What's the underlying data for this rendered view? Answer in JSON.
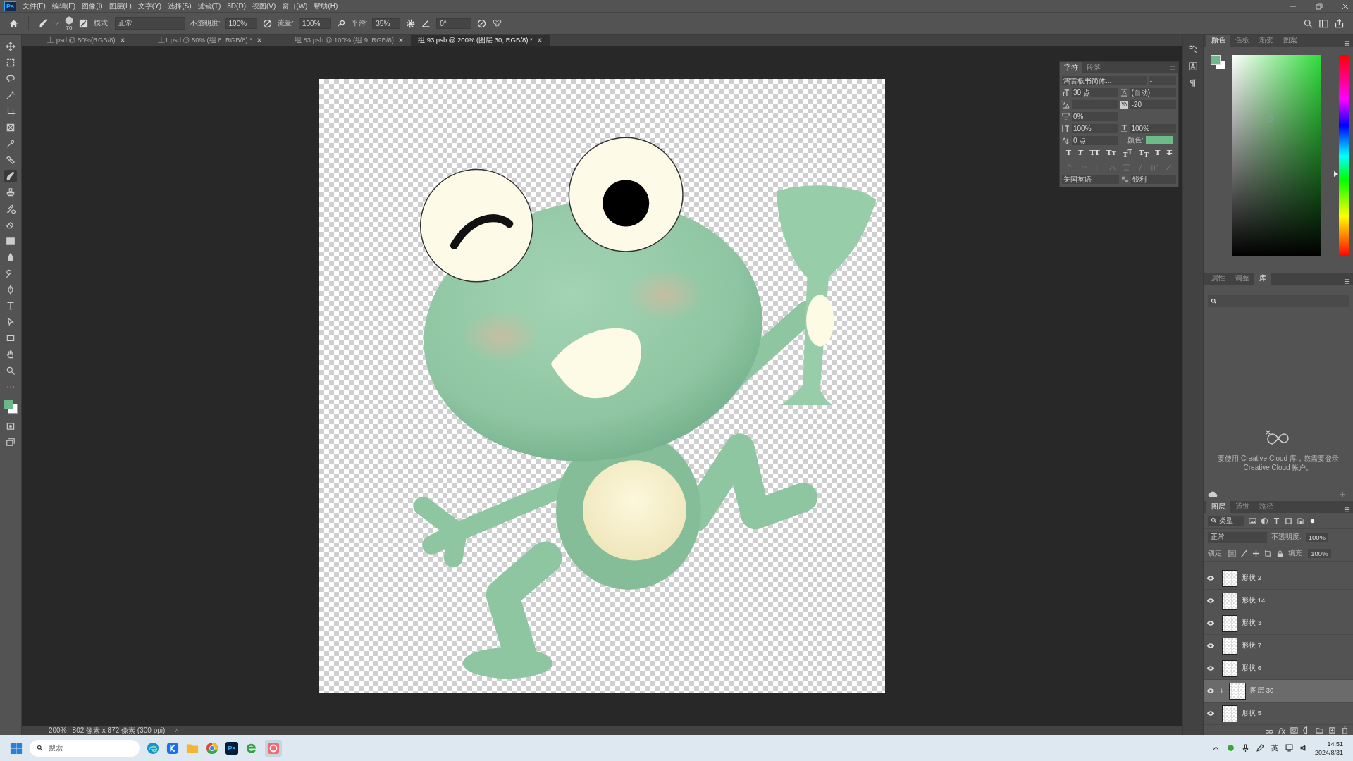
{
  "app_logo": "Ps",
  "menu": [
    "文件(F)",
    "编辑(E)",
    "图像(I)",
    "图层(L)",
    "文字(Y)",
    "选择(S)",
    "滤镜(T)",
    "3D(D)",
    "视图(V)",
    "窗口(W)",
    "帮助(H)"
  ],
  "options_bar": {
    "brush_size": "70",
    "mode_label": "模式:",
    "mode": "正常",
    "opacity_label": "不透明度:",
    "opacity": "100%",
    "flow_label": "流量:",
    "flow": "100%",
    "smoothing_label": "平滑:",
    "smoothing": "35%",
    "angle": "0°"
  },
  "hue_slider": {
    "level": 0.41
  },
  "tools": [
    {
      "kind": "move",
      "selected": false
    },
    {
      "kind": "marquee",
      "selected": false
    },
    {
      "kind": "lasso",
      "selected": false
    },
    {
      "kind": "wand",
      "selected": false
    },
    {
      "kind": "crop",
      "selected": false
    },
    {
      "kind": "frame",
      "selected": false
    },
    {
      "kind": "eyedropper",
      "selected": false
    },
    {
      "kind": "healing",
      "selected": false
    },
    {
      "kind": "brush",
      "selected": true
    },
    {
      "kind": "stamp",
      "selected": false
    },
    {
      "kind": "history",
      "selected": false
    },
    {
      "kind": "eraser",
      "selected": false
    },
    {
      "kind": "gradient",
      "selected": false
    },
    {
      "kind": "blur",
      "selected": false
    },
    {
      "kind": "dodge",
      "selected": false
    },
    {
      "kind": "pen",
      "selected": false
    },
    {
      "kind": "type",
      "selected": false
    },
    {
      "kind": "select",
      "selected": false
    },
    {
      "kind": "rectangle",
      "selected": false
    },
    {
      "kind": "hand",
      "selected": false
    },
    {
      "kind": "zoom",
      "selected": false
    },
    {
      "kind": "more",
      "selected": false
    }
  ],
  "document_tabs": [
    {
      "title": "土.psd @ 50%(RGB/8)",
      "selected": false
    },
    {
      "title": "土1.psd @ 50% (组 8, RGB/8) *",
      "selected": false
    },
    {
      "title": "组 83.psb @ 100% (组 9, RGB/8)",
      "selected": false
    },
    {
      "title": "组 93.psb @ 200% (图层 30, RGB/8) *",
      "selected": true
    }
  ],
  "character_panel": {
    "tabs": [
      {
        "label": "字符",
        "selected": true
      },
      {
        "label": "段落",
        "selected": false
      }
    ],
    "font_family": "鸿雷板书简体...",
    "font_style": "-",
    "font_size": "30 点",
    "leading": "(自动)",
    "tracking": "-20",
    "tsume": "0%",
    "vertical_scale": "100%",
    "horizontal_scale": "100%",
    "baseline_shift": "0 点",
    "color_label": "颜色:",
    "color": "#6dbb88",
    "style_buttons": [
      "T",
      "T",
      "TT",
      "Tᴛ",
      "T$^{T}$",
      "T$_{T}$",
      "T",
      "T"
    ],
    "language": "美国英语",
    "antialias": "锐利"
  },
  "color_panel": {
    "tabs": [
      {
        "label": "颜色",
        "selected": true
      },
      {
        "label": "色板",
        "selected": false
      },
      {
        "label": "渐变",
        "selected": false
      },
      {
        "label": "图案",
        "selected": false
      }
    ]
  },
  "library_panel": {
    "tabs": [
      {
        "label": "属性",
        "selected": false
      },
      {
        "label": "调整",
        "selected": false
      },
      {
        "label": "库",
        "selected": true
      }
    ],
    "message": "要使用 Creative Cloud 库，您需要登录 Creative Cloud 帐户。"
  },
  "layers_panel": {
    "tabs": [
      {
        "label": "图层",
        "selected": true
      },
      {
        "label": "通道",
        "selected": false
      },
      {
        "label": "路径",
        "selected": false
      }
    ],
    "filter": "类型",
    "blend_mode": "正常",
    "opacity_label": "不透明度:",
    "opacity": "100%",
    "lock_label": "锁定:",
    "fill_label": "填充:",
    "fill": "100%",
    "layers": [
      {
        "name": "形状 2",
        "visible": true,
        "selected": false,
        "clipped": false
      },
      {
        "name": "形状 14",
        "visible": true,
        "selected": false,
        "clipped": false
      },
      {
        "name": "形状 3",
        "visible": true,
        "selected": false,
        "clipped": false
      },
      {
        "name": "形状 7",
        "visible": true,
        "selected": false,
        "clipped": false
      },
      {
        "name": "形状 6",
        "visible": true,
        "selected": false,
        "clipped": false
      },
      {
        "name": "图层 30",
        "visible": true,
        "selected": true,
        "clipped": true
      },
      {
        "name": "形状 5",
        "visible": true,
        "selected": false,
        "clipped": false
      }
    ]
  },
  "status_bar": {
    "zoom": "200%",
    "doc_info": "802 像素 x 872 像素 (300 ppi)"
  },
  "taskbar": {
    "search_placeholder": "搜索",
    "ps_label": "Ps",
    "input_method": "英",
    "time": "14:51",
    "date": "2024/8/31"
  }
}
